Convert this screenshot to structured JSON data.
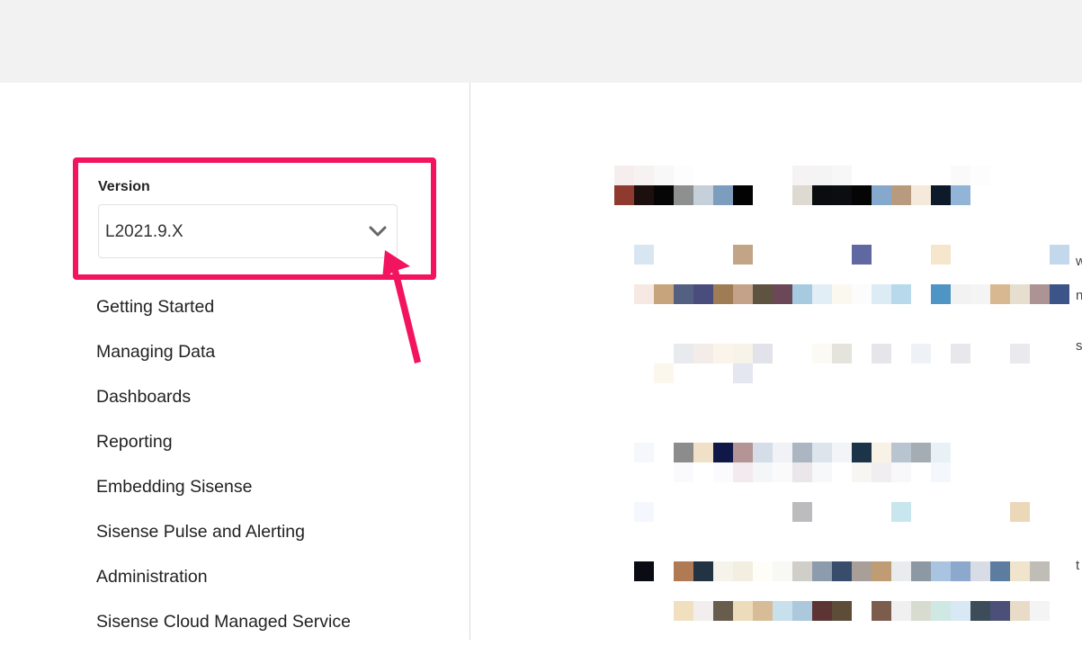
{
  "sidebar": {
    "version_label": "Version",
    "version_value": "L2021.9.X",
    "chevron_icon": "chevron-down-icon",
    "nav_items": [
      {
        "label": "Getting Started"
      },
      {
        "label": "Managing Data"
      },
      {
        "label": "Dashboards"
      },
      {
        "label": "Reporting"
      },
      {
        "label": "Embedding Sisense"
      },
      {
        "label": "Sisense Pulse and Alerting"
      },
      {
        "label": "Administration"
      },
      {
        "label": "Sisense Cloud Managed Service"
      }
    ]
  },
  "annotation": {
    "highlight_color": "#f2145e",
    "arrow_icon": "pointer-arrow-icon"
  },
  "content": {
    "pixelated": true,
    "edge_glyphs": [
      "w",
      "n",
      "s",
      "t"
    ]
  }
}
